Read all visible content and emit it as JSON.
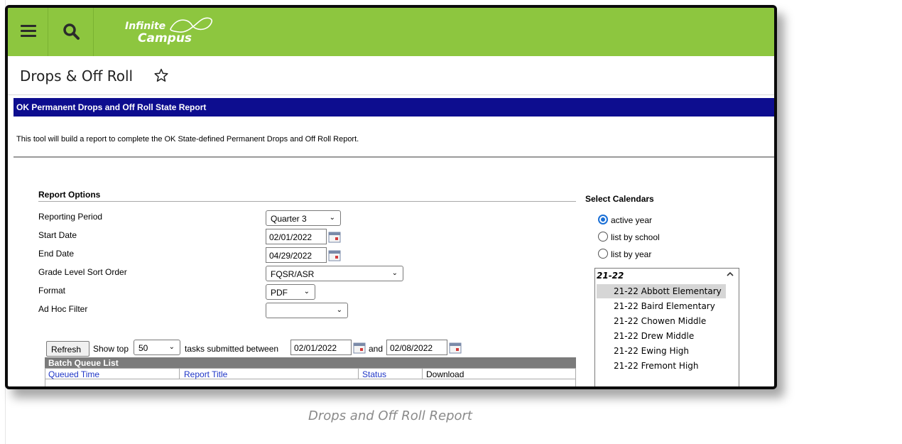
{
  "app": {
    "logo_line1": "Infinite",
    "logo_line2": "Campus",
    "brand_color": "#8dc63f",
    "header_color": "#0d0d8f"
  },
  "page": {
    "title": "Drops & Off Roll"
  },
  "report": {
    "header": "OK Permanent Drops and Off Roll State Report",
    "description": "This tool will build a report to complete the OK State-defined Permanent Drops and Off Roll Report."
  },
  "options": {
    "section_title": "Report Options",
    "reporting_period_label": "Reporting Period",
    "reporting_period_value": "Quarter 3",
    "start_date_label": "Start Date",
    "start_date_value": "02/01/2022",
    "end_date_label": "End Date",
    "end_date_value": "04/29/2022",
    "grade_sort_label": "Grade Level Sort Order",
    "grade_sort_value": "FQSR/ASR",
    "format_label": "Format",
    "format_value": "PDF",
    "adhoc_label": "Ad Hoc Filter",
    "adhoc_value": ""
  },
  "batch": {
    "refresh_label": "Refresh",
    "show_top_label": "Show top",
    "show_top_value": "50",
    "tasks_between_label": "tasks submitted between",
    "from_date": "02/01/2022",
    "and_label": "and",
    "to_date": "02/08/2022",
    "list_title": "Batch Queue List",
    "columns": [
      "Queued Time",
      "Report Title",
      "Status",
      "Download"
    ]
  },
  "calendars": {
    "title": "Select Calendars",
    "radios": [
      {
        "label": "active year",
        "selected": true
      },
      {
        "label": "list by school",
        "selected": false
      },
      {
        "label": "list by year",
        "selected": false
      }
    ],
    "group": "21-22",
    "items": [
      "21-22 Abbott Elementary",
      "21-22 Baird Elementary",
      "21-22 Chowen Middle",
      "21-22 Drew Middle",
      "21-22 Ewing High",
      "21-22 Fremont High"
    ]
  },
  "caption": "Drops and Off Roll Report"
}
